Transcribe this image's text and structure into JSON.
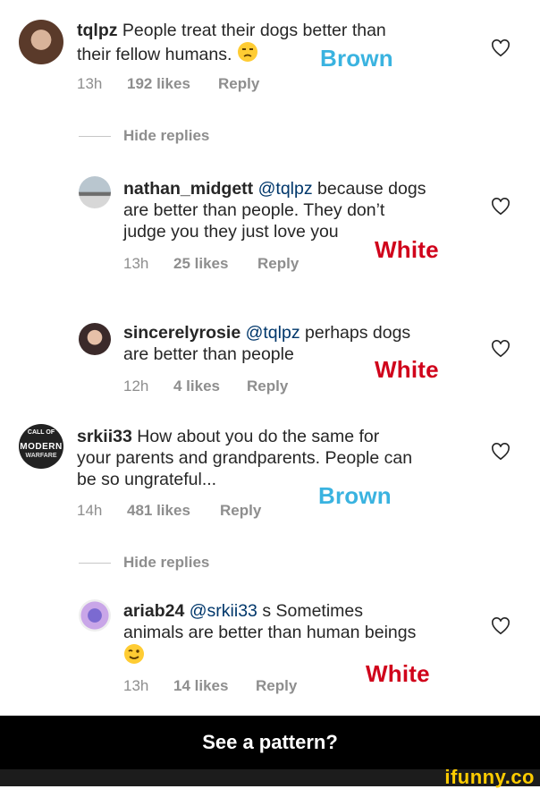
{
  "comments": [
    {
      "user": "tqlpz",
      "mention": "",
      "line1": "People treat their dogs better than",
      "line2": "their fellow humans.",
      "line3": "",
      "time": "13h",
      "likes": "192 likes",
      "reply": "Reply",
      "tag": "Brown"
    },
    {
      "user": "nathan_midgett",
      "mention": "@tqlpz",
      "line1": "because dogs",
      "line2": "are better than people. They don’t",
      "line3": "judge you they just love you",
      "time": "13h",
      "likes": "25 likes",
      "reply": "Reply",
      "tag": "White"
    },
    {
      "user": "sincerelyrosie",
      "mention": "@tqlpz",
      "line1": "perhaps dogs",
      "line2": "are better than people",
      "line3": "",
      "time": "12h",
      "likes": "4 likes",
      "reply": "Reply",
      "tag": "White"
    },
    {
      "user": "srkii33",
      "mention": "",
      "line1": "How about you do the same for",
      "line2": "your parents and grandparents. People can",
      "line3": "be so ungrateful...",
      "time": "14h",
      "likes": "481 likes",
      "reply": "Reply",
      "tag": "Brown"
    },
    {
      "user": "ariab24",
      "mention": "@srkii33",
      "line1": "s Sometimes",
      "line2": "animals are better than human beings",
      "line3": "",
      "time": "13h",
      "likes": "14 likes",
      "reply": "Reply",
      "tag": "White"
    }
  ],
  "hide_replies": "Hide replies",
  "avatar_text": {
    "srkii33_top": "CALL OF",
    "srkii33_mid": "MODERN",
    "srkii33_bot": "WARFARE"
  },
  "footer": "See a pattern?",
  "watermark": "ifunny.co",
  "colors": {
    "brown_tag": "#3ab3e0",
    "white_tag": "#d0021b",
    "mention": "#00376b",
    "meta": "#8e8e8e"
  },
  "icons": {
    "heart": "heart-outline-icon",
    "emoji_unamused": "unamused-face-icon",
    "emoji_wink": "winking-face-icon"
  }
}
